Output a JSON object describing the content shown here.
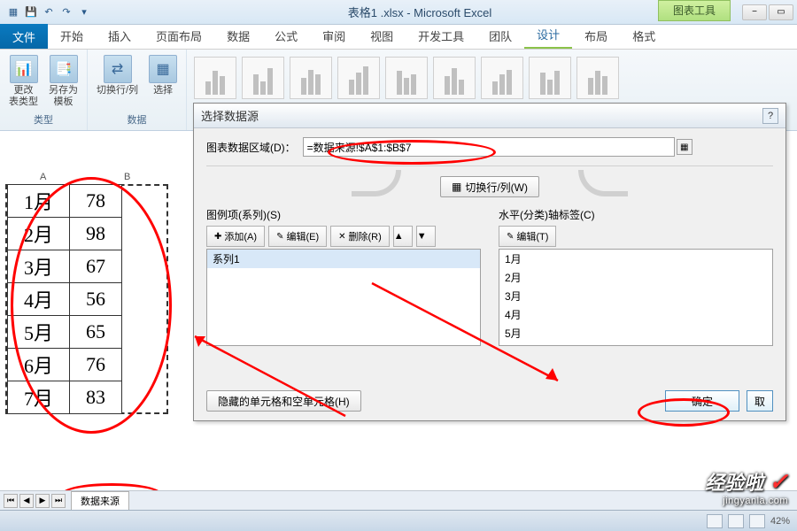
{
  "titlebar": {
    "doc_title": "表格1 .xlsx - Microsoft Excel",
    "context_tab": "图表工具"
  },
  "ribbon_tabs": {
    "file": "文件",
    "tabs": [
      "开始",
      "插入",
      "页面布局",
      "数据",
      "公式",
      "审阅",
      "视图",
      "开发工具",
      "团队",
      "设计",
      "布局",
      "格式"
    ],
    "active_index": 9
  },
  "ribbon": {
    "change_type": "更改\n表类型",
    "save_template": "另存为\n模板",
    "group_type": "类型",
    "switch_rowcol": "切换行/列",
    "select_data": "选择",
    "group_data": "数据"
  },
  "table": {
    "col_a": "A",
    "col_b": "B",
    "rows": [
      {
        "month": "1月",
        "val": "78"
      },
      {
        "month": "2月",
        "val": "98"
      },
      {
        "month": "3月",
        "val": "67"
      },
      {
        "month": "4月",
        "val": "56"
      },
      {
        "month": "5月",
        "val": "65"
      },
      {
        "month": "6月",
        "val": "76"
      },
      {
        "month": "7月",
        "val": "83"
      }
    ]
  },
  "dialog": {
    "title": "选择数据源",
    "help": "?",
    "range_label": "图表数据区域(D)：",
    "range_value": "=数据来源!$A$1:$B$7",
    "switch_btn": "切换行/列(W)",
    "legend_title": "图例项(系列)(S)",
    "axis_title": "水平(分类)轴标签(C)",
    "btn_add": "添加(A)",
    "btn_edit": "编辑(E)",
    "btn_delete": "删除(R)",
    "btn_edit2": "编辑(T)",
    "btn_updown_up": "▲",
    "btn_updown_down": "▼",
    "series": [
      "系列1"
    ],
    "categories": [
      "1月",
      "2月",
      "3月",
      "4月",
      "5月"
    ],
    "hidden_btn": "隐藏的单元格和空单元格(H)",
    "ok": "确定",
    "cancel_partial": "取"
  },
  "sheet_tabs": {
    "tab1": "数据来源"
  },
  "statusbar": {
    "zoom": "42%"
  },
  "watermark": {
    "text": "经验啦",
    "check": "✓",
    "url": "jingyanla.com"
  },
  "chart_data": {
    "type": "bar",
    "categories": [
      "1月",
      "2月",
      "3月",
      "4月",
      "5月",
      "6月",
      "7月"
    ],
    "series": [
      {
        "name": "系列1",
        "values": [
          78,
          98,
          67,
          56,
          65,
          76,
          83
        ]
      }
    ],
    "title": "",
    "xlabel": "",
    "ylabel": ""
  }
}
